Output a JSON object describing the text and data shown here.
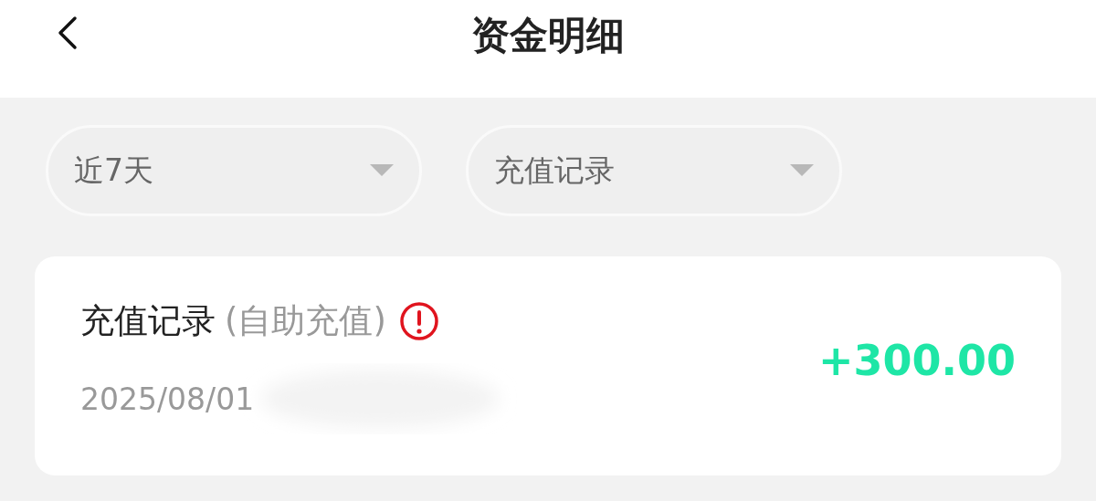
{
  "header": {
    "title": "资金明细"
  },
  "filters": [
    {
      "label": "近7天"
    },
    {
      "label": "充值记录"
    }
  ],
  "records": [
    {
      "title": "充值记录",
      "subtitle": "(自助充值)",
      "date": "2025/08/01",
      "amount": "+300.00",
      "warning": true
    }
  ]
}
